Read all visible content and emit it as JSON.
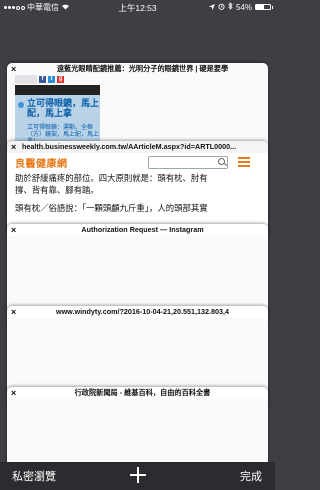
{
  "status_bar": {
    "carrier": "中華電信",
    "time": "上午12:53",
    "battery_percent_label": "54%",
    "battery_level": 0.54
  },
  "tabs": [
    {
      "title": "遠藍光眼睛配鏡推薦：光明分子的眼鏡世界 | 硬是要學",
      "close_label": "×"
    },
    {
      "title": "health.businessweekly.com.tw/AArticleM.aspx?id=ARTL0000...",
      "close_label": "×"
    },
    {
      "title": "Authorization Request — Instagram",
      "close_label": "×"
    },
    {
      "title": "www.windyty.com/?2016-10-04-21,20.551,132.803,4",
      "close_label": "×"
    },
    {
      "title": "行政院新聞局 - 維基百科，自由的百科全書",
      "close_label": "×"
    }
  ],
  "card1": {
    "ad_heading": "立可得眼鏡，馬上配，馬上拿",
    "ad_sub": "立可得眼鏡：運動、全框（方）鏡架，馬上配，馬上拿！",
    "toolbar_icons": [
      "☰",
      "♥",
      "+",
      "⋮"
    ]
  },
  "card2": {
    "logo": "良醫健康網",
    "line1": "助於舒緩痛疼的部位。四大原則就是：頭有枕、肘有",
    "line2": "撐、背有靠、腳有踏。",
    "line3": "頭有枕／俗語說：「一顆頭顱九斤重」，人的頭部其實"
  },
  "bottom_bar": {
    "private_label": "私密瀏覽",
    "done_label": "完成"
  },
  "colors": {
    "background": "#3e3e44",
    "card": "#f4f4f4",
    "logo_orange": "#e87a1a"
  }
}
